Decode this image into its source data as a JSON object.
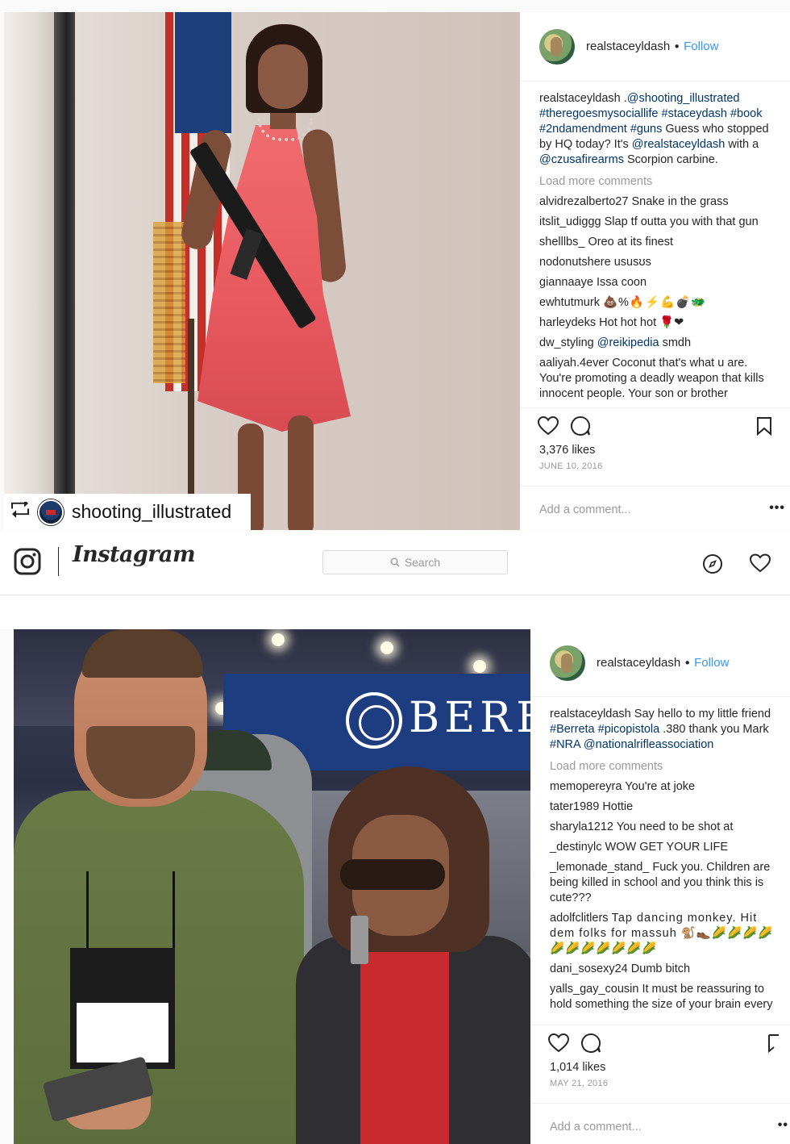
{
  "post1": {
    "repost": {
      "username": "shooting_illustrated"
    },
    "header": {
      "username": "realstaceyldash",
      "separator": "•",
      "follow": "Follow"
    },
    "caption": {
      "username": "realstaceyldash",
      "text_parts": [
        ".@shooting_illustrated",
        "#theregoesmysociallife #staceydash #book #2ndamendment #guns",
        "Guess who stopped by HQ today? It's",
        "@realstaceyldash",
        "with a",
        "@czusafirearms",
        "Scorpion carbine."
      ]
    },
    "load_more": "Load more comments",
    "comments": [
      {
        "user": "alvidrezalberto27",
        "text": "Snake in the grass"
      },
      {
        "user": "itslit_udiggg",
        "text": "Slap tf outta you with that gun"
      },
      {
        "user": "shelllbs_",
        "text": "Oreo at its finest"
      },
      {
        "user": "nodonutshere",
        "text": "ususʊѕ"
      },
      {
        "user": "giannaaye",
        "text": "Issa coon"
      },
      {
        "user": "ewhtutmurk",
        "text": "💩%🔥⚡💪💣🐲"
      },
      {
        "user": "harleydeks",
        "text": "Hot hot hot 🌹❤"
      },
      {
        "user": "dw_styling",
        "mention": "@reikipedia",
        "text": "smdh"
      },
      {
        "user": "aaliyah.4ever",
        "text": "Coconut that's what u are. You're promoting a deadly weapon that kills innocent people. Your son or brother"
      }
    ],
    "likes": "3,376 likes",
    "date": "JUNE 10, 2016",
    "add_comment_placeholder": "Add a comment...",
    "more": "•••"
  },
  "navbar": {
    "wordmark": "Instagram",
    "search_placeholder": "Search"
  },
  "post2": {
    "banner_text": "BERET",
    "header": {
      "username": "realstaceyldash",
      "separator": "•",
      "follow": "Follow"
    },
    "caption": {
      "username": "realstaceyldash",
      "text_parts": [
        "Say hello to my little friend",
        "#Berreta #picopistola",
        ".380 thank you Mark",
        "#NRA @nationalrifleassociation"
      ]
    },
    "load_more": "Load more comments",
    "comments": [
      {
        "user": "memopereyra",
        "text": "You're at joke"
      },
      {
        "user": "tater1989",
        "text": "Hottie"
      },
      {
        "user": "sharyla1212",
        "text": "You need to be shot at"
      },
      {
        "user": "_destinylc",
        "text": "WOW GET YOUR LIFE"
      },
      {
        "user": "_lemonade_stand_",
        "text": "Fuck you. Children are being killed in school and you think this is cute???"
      },
      {
        "user": "adolfclitlers",
        "text": "Tap dancing monkey. Hit dem folks for massuh 🐒👞🌽🌽🌽🌽🌽🌽🌽🌽🌽🌽🌽"
      },
      {
        "user": "dani_sosexy24",
        "text": "Dumb bitch"
      },
      {
        "user": "yalls_gay_cousin",
        "text": "It must be reassuring to hold something the size of your brain every"
      }
    ],
    "likes": "1,014 likes",
    "date": "MAY 21, 2016",
    "add_comment_placeholder": "Add a comment...",
    "more": "••"
  }
}
